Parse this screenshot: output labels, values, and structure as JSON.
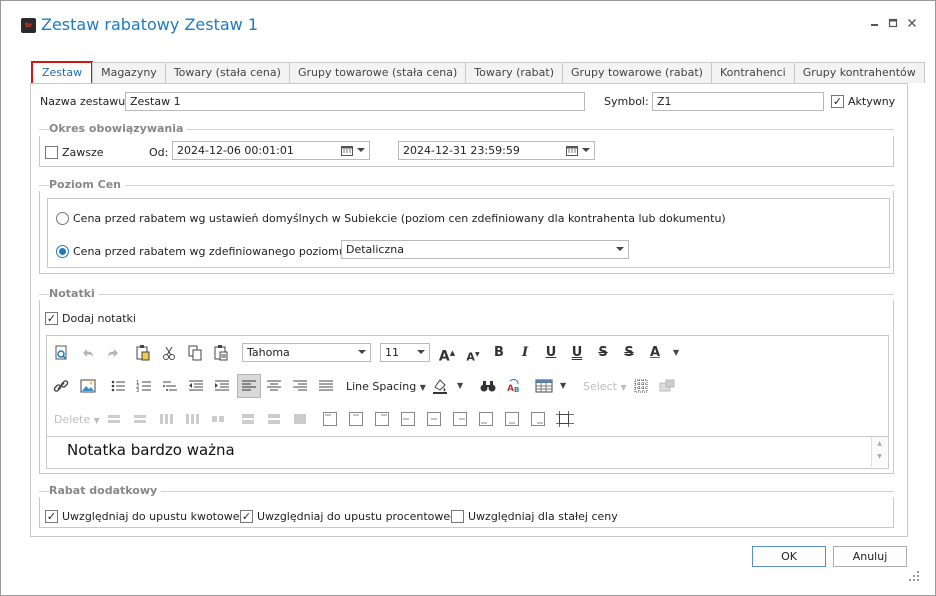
{
  "window": {
    "app_icon": "Sr",
    "title": "Zestaw rabatowy Zestaw 1",
    "controls": [
      "minimize-icon",
      "maximize-icon",
      "close-icon"
    ]
  },
  "tabs": [
    {
      "label": "Zestaw",
      "active": true
    },
    {
      "label": "Magazyny"
    },
    {
      "label": "Towary (stała cena)"
    },
    {
      "label": "Grupy towarowe (stała cena)"
    },
    {
      "label": "Towary (rabat)"
    },
    {
      "label": "Grupy towarowe (rabat)"
    },
    {
      "label": "Kontrahenci"
    },
    {
      "label": "Grupy kontrahentów"
    }
  ],
  "form": {
    "name_label": "Nazwa zestawu:",
    "name_value": "Zestaw 1",
    "symbol_label": "Symbol:",
    "symbol_value": "Z1",
    "active_label": "Aktywny",
    "active_checked": true
  },
  "period": {
    "title": "Okres obowiązywania",
    "always_label": "Zawsze",
    "always_checked": false,
    "from_label": "Od:",
    "from_value": "2024-12-06 00:01:01",
    "to_value": "2024-12-31 23:59:59"
  },
  "price_level": {
    "title": "Poziom Cen",
    "option1": "Cena przed rabatem wg ustawień domyślnych w Subiekcie (poziom cen zdefiniowany dla kontrahenta lub dokumentu)",
    "option2": "Cena przed rabatem wg zdefiniowanego poziomu cen",
    "selected_option": 2,
    "level_value": "Detaliczna"
  },
  "notes": {
    "title": "Notatki",
    "add_notes_label": "Dodaj notatki",
    "add_notes_checked": true,
    "font_name": "Tahoma",
    "font_size": "11",
    "line_spacing_label": "Line Spacing",
    "select_label": "Select",
    "delete_label": "Delete",
    "content": "Notatka bardzo ważna"
  },
  "extra_discount": {
    "title": "Rabat dodatkowy",
    "opt_amount": "Uwzględniaj do upustu kwotowego",
    "opt_amount_checked": true,
    "opt_percent": "Uwzględniaj do upustu procentowego",
    "opt_percent_checked": true,
    "opt_fixed": "Uwzględniaj dla stałej ceny",
    "opt_fixed_checked": false
  },
  "footer": {
    "ok_label": "OK",
    "cancel_label": "Anuluj"
  },
  "colors": {
    "accent": "#1e7bc0",
    "tab_highlight": "#d01818"
  }
}
